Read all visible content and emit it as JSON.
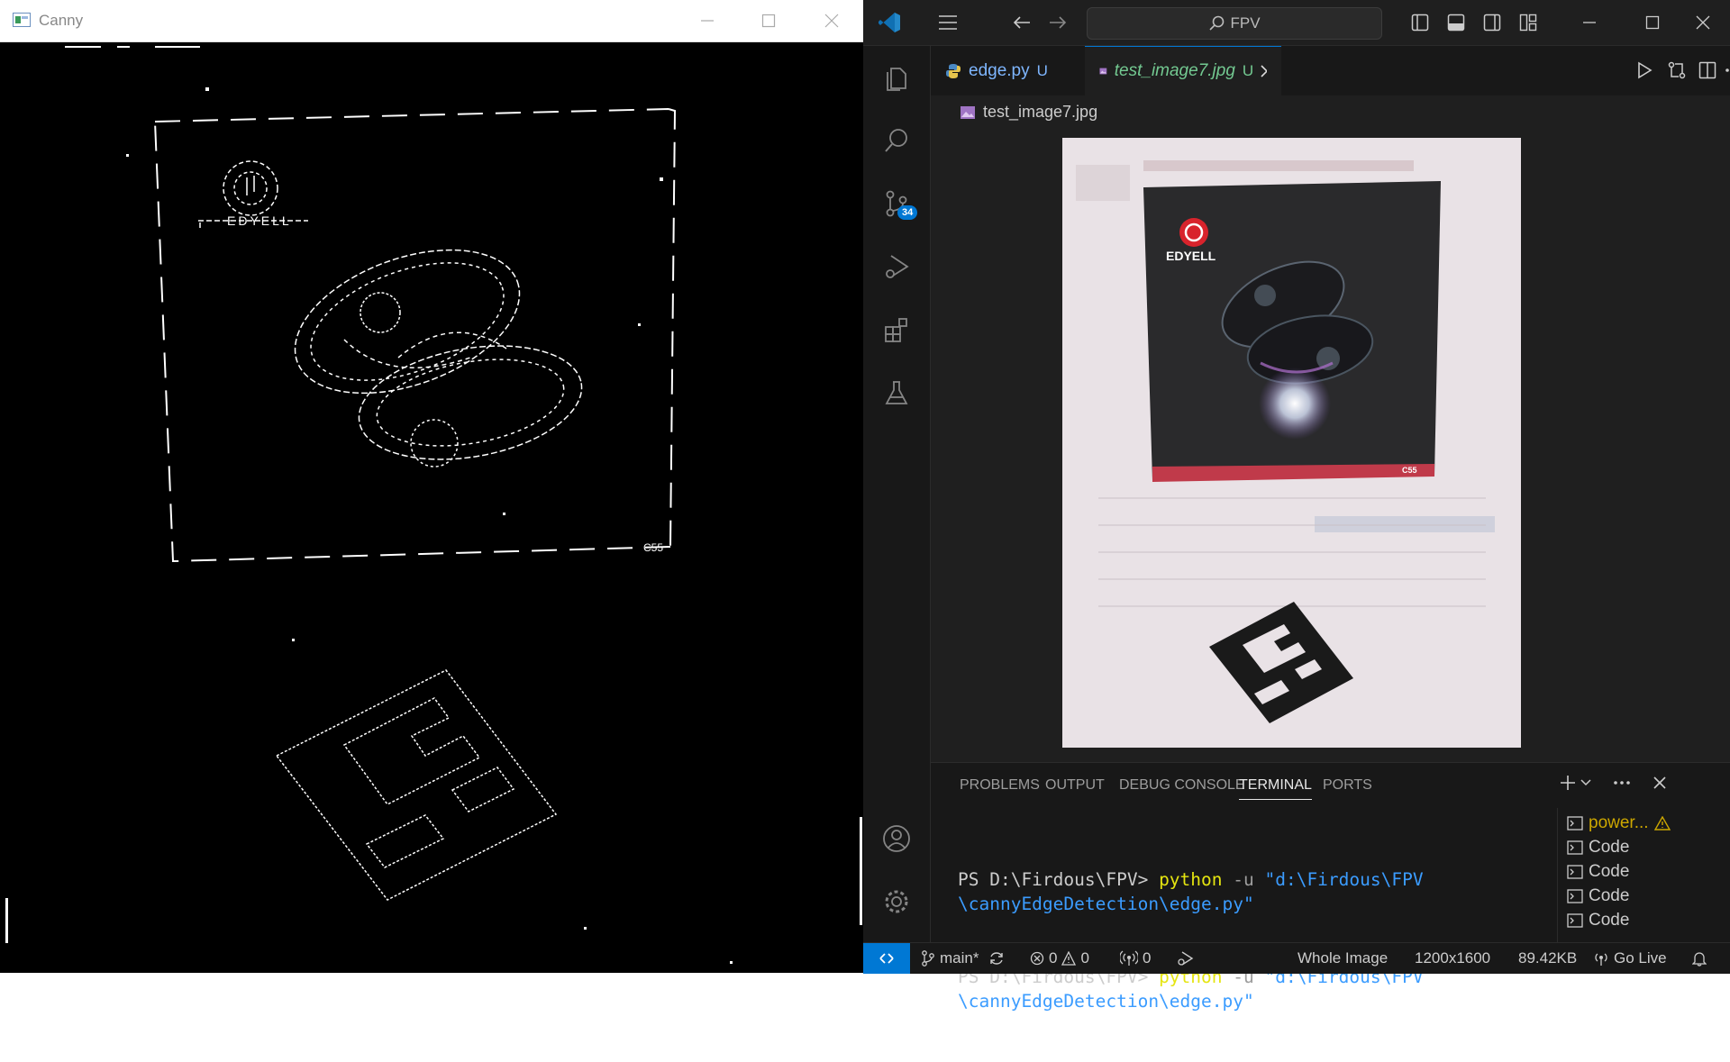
{
  "canny_window": {
    "title": "Canny",
    "edge_logo_text": "EDYELL",
    "edge_model_text": "C55"
  },
  "vscode": {
    "search_label": "FPV",
    "tabs": [
      {
        "name": "edge.py",
        "status": "U",
        "icon": "python-file-icon"
      },
      {
        "name": "test_image7.jpg",
        "status": "U",
        "icon": "image-file-icon",
        "active": true
      }
    ],
    "breadcrumb": "test_image7.jpg",
    "preview": {
      "brand": "EDYELL",
      "model": "C55"
    },
    "activity_badge": "34",
    "panel": {
      "tabs": [
        "PROBLEMS",
        "OUTPUT",
        "DEBUG CONSOLE",
        "TERMINAL",
        "PORTS"
      ],
      "active_tab": "TERMINAL",
      "terminal_lines": [
        {
          "prompt": "PS D:\\Firdous\\FPV> ",
          "cmd": "python",
          "flag": " -u ",
          "arg": "\"d:\\Firdous\\FPV\\cannyEdgeDetection\\edge.py\""
        },
        {
          "prompt": "PS D:\\Firdous\\FPV> ",
          "cmd": "python",
          "flag": " -u ",
          "arg": "\"d:\\Firdous\\FPV\\cannyEdgeDetection\\edge.py\""
        }
      ],
      "terminal_instances": [
        "power...",
        "Code",
        "Code",
        "Code",
        "Code"
      ]
    },
    "status_bar": {
      "branch": "main*",
      "errors": "0",
      "warnings": "0",
      "ports": "0",
      "image_mode": "Whole Image",
      "dimensions": "1200x1600",
      "file_size": "89.42KB",
      "go_live": "Go Live"
    }
  }
}
